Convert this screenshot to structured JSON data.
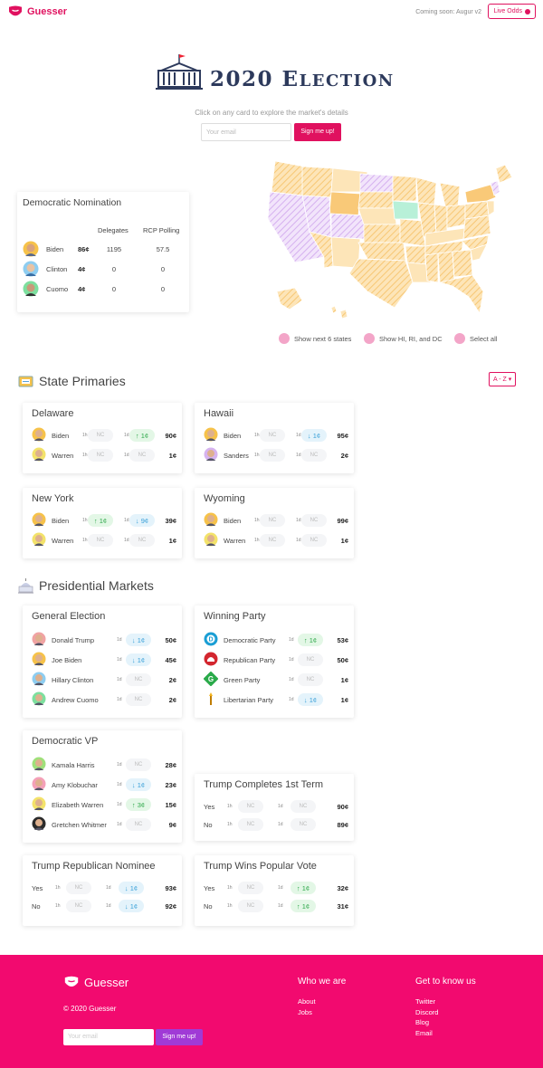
{
  "header": {
    "brand": "Guesser",
    "coming_soon": "Coming soon: Augur v2",
    "live_odds": "Live Odds"
  },
  "hero": {
    "title_main": "2020 E",
    "title_small": "LECTION",
    "subtitle": "Click on any card to explore the market's details",
    "email_placeholder": "Your email",
    "signup": "Sign me up!"
  },
  "nomination": {
    "title": "Democratic Nomination",
    "col_delegates": "Delegates",
    "col_polling": "RCP Polling",
    "rows": [
      {
        "name": "Biden",
        "price": "86¢",
        "delegates": "1195",
        "polling": "57.5"
      },
      {
        "name": "Clinton",
        "price": "4¢",
        "delegates": "0",
        "polling": "0"
      },
      {
        "name": "Cuomo",
        "price": "4¢",
        "delegates": "0",
        "polling": "0"
      }
    ]
  },
  "map_legend": {
    "next": "Show next 6 states",
    "hi": "Show HI, RI, and DC",
    "all": "Select all"
  },
  "colors": {
    "accent": "#e0115f",
    "footer": "#f20a6f",
    "up": "#2ea84a",
    "down": "#3aa0d8",
    "map_orange": "#f9c978",
    "map_purple": "#d9b3f0",
    "map_green": "#b8f0d8"
  },
  "state_primaries": {
    "title": "State Primaries",
    "sort": "A - Z",
    "cards": [
      {
        "title": "Delaware",
        "rows": [
          {
            "name": "Biden",
            "p1h": "NC",
            "p1d": "↑ 1¢",
            "d1": "up",
            "price": "90¢"
          },
          {
            "name": "Warren",
            "p1h": "NC",
            "p1d": "NC",
            "d1": "",
            "price": "1¢"
          }
        ]
      },
      {
        "title": "Hawaii",
        "rows": [
          {
            "name": "Biden",
            "p1h": "NC",
            "p1d": "↓ 1¢",
            "d1": "dn",
            "price": "95¢"
          },
          {
            "name": "Sanders",
            "p1h": "NC",
            "p1d": "NC",
            "d1": "",
            "price": "2¢"
          }
        ]
      },
      {
        "title": "New York",
        "rows": [
          {
            "name": "Biden",
            "p1h": "↑ 1¢",
            "h1": "up",
            "p1d": "↓ 9¢",
            "d1": "dn",
            "price": "39¢"
          },
          {
            "name": "Warren",
            "p1h": "NC",
            "p1d": "NC",
            "d1": "",
            "price": "1¢"
          }
        ]
      },
      {
        "title": "Wyoming",
        "rows": [
          {
            "name": "Biden",
            "p1h": "NC",
            "p1d": "NC",
            "d1": "",
            "price": "99¢"
          },
          {
            "name": "Warren",
            "p1h": "NC",
            "p1d": "NC",
            "d1": "",
            "price": "1¢"
          }
        ]
      }
    ]
  },
  "presidential": {
    "title": "Presidential Markets",
    "general": {
      "title": "General Election",
      "rows": [
        {
          "name": "Donald Trump",
          "p": "↓ 1¢",
          "d": "dn",
          "price": "50¢"
        },
        {
          "name": "Joe Biden",
          "p": "↓ 1¢",
          "d": "dn",
          "price": "45¢"
        },
        {
          "name": "Hillary Clinton",
          "p": "NC",
          "d": "",
          "price": "2¢"
        },
        {
          "name": "Andrew Cuomo",
          "p": "NC",
          "d": "",
          "price": "2¢"
        }
      ]
    },
    "party": {
      "title": "Winning Party",
      "rows": [
        {
          "name": "Democratic Party",
          "p": "↑ 1¢",
          "d": "up",
          "price": "53¢"
        },
        {
          "name": "Republican Party",
          "p": "NC",
          "d": "",
          "price": "50¢"
        },
        {
          "name": "Green Party",
          "p": "NC",
          "d": "",
          "price": "1¢"
        },
        {
          "name": "Libertarian Party",
          "p": "↓ 1¢",
          "d": "dn",
          "price": "1¢"
        }
      ]
    },
    "vp": {
      "title": "Democratic VP",
      "rows": [
        {
          "name": "Kamala Harris",
          "p": "NC",
          "d": "",
          "price": "28¢"
        },
        {
          "name": "Amy Klobuchar",
          "p": "↓ 1¢",
          "d": "dn",
          "price": "23¢"
        },
        {
          "name": "Elizabeth Warren",
          "p": "↑ 3¢",
          "d": "up",
          "price": "15¢"
        },
        {
          "name": "Gretchen Whitmer",
          "p": "NC",
          "d": "",
          "price": "9¢"
        }
      ]
    },
    "term": {
      "title": "Trump Completes 1st Term",
      "rows": [
        {
          "name": "Yes",
          "h": "NC",
          "p": "NC",
          "d": "",
          "price": "90¢"
        },
        {
          "name": "No",
          "h": "NC",
          "p": "NC",
          "d": "",
          "price": "89¢"
        }
      ]
    },
    "nominee": {
      "title": "Trump Republican Nominee",
      "rows": [
        {
          "name": "Yes",
          "h": "NC",
          "p": "↓ 1¢",
          "d": "dn",
          "price": "93¢"
        },
        {
          "name": "No",
          "h": "NC",
          "p": "↓ 1¢",
          "d": "dn",
          "price": "92¢"
        }
      ]
    },
    "popular": {
      "title": "Trump Wins Popular Vote",
      "rows": [
        {
          "name": "Yes",
          "h": "NC",
          "p": "↑ 1¢",
          "d": "up",
          "price": "32¢"
        },
        {
          "name": "No",
          "h": "NC",
          "p": "↑ 1¢",
          "d": "up",
          "price": "31¢"
        }
      ]
    }
  },
  "labels": {
    "h": "1h",
    "d": "1d"
  },
  "footer": {
    "brand": "Guesser",
    "copyright": "© 2020 Guesser",
    "email_placeholder": "Your email",
    "signup": "Sign me up!",
    "who_title": "Who we are",
    "who_links": [
      "About",
      "Jobs"
    ],
    "know_title": "Get to know us",
    "know_links": [
      "Twitter",
      "Discord",
      "Blog",
      "Email"
    ]
  }
}
